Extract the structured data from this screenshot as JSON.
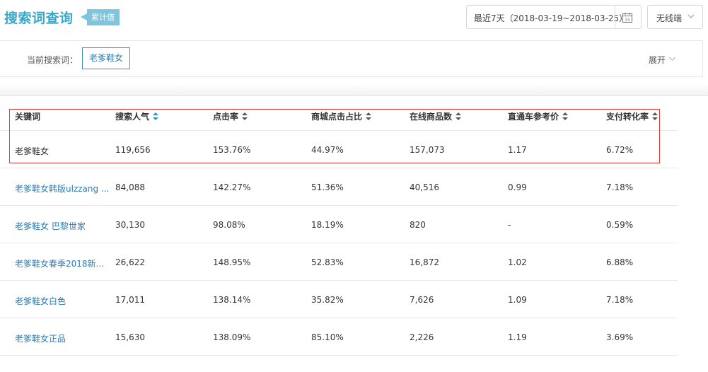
{
  "header": {
    "title": "搜索词查询",
    "tag": "累计值",
    "date_range": "最近7天（2018-03-19~2018-03-25）",
    "calendar_day": "15",
    "device": "无线端"
  },
  "search": {
    "label": "当前搜索词：",
    "keyword": "老爹鞋女",
    "expand": "展开"
  },
  "table": {
    "columns": [
      "关键词",
      "搜索人气",
      "点击率",
      "商城点击占比",
      "在线商品数",
      "直通车参考价",
      "支付转化率"
    ],
    "rows": [
      [
        "老爹鞋女",
        "119,656",
        "153.76%",
        "44.97%",
        "157,073",
        "1.17",
        "6.72%"
      ],
      [
        "老爹鞋女韩版ulzzang ...",
        "84,088",
        "142.27%",
        "51.36%",
        "40,516",
        "0.99",
        "7.18%"
      ],
      [
        "老爹鞋女 巴黎世家",
        "30,130",
        "98.08%",
        "18.19%",
        "820",
        "-",
        "0.59%"
      ],
      [
        "老爹鞋女春季2018新...",
        "26,622",
        "148.95%",
        "52.83%",
        "16,872",
        "1.02",
        "6.88%"
      ],
      [
        "老爹鞋女白色",
        "17,011",
        "138.14%",
        "35.82%",
        "7,626",
        "1.09",
        "7.18%"
      ],
      [
        "老爹鞋女正品",
        "15,630",
        "138.09%",
        "85.10%",
        "2,226",
        "1.19",
        "3.69%"
      ]
    ]
  },
  "colors": {
    "title": "#3aa7c9",
    "tag_bg": "#7fc5dd",
    "link": "#2d7cb4",
    "highlight_border": "#e03b3b",
    "sort_active": "#3b8fc2",
    "sort_inactive": "#555555"
  }
}
